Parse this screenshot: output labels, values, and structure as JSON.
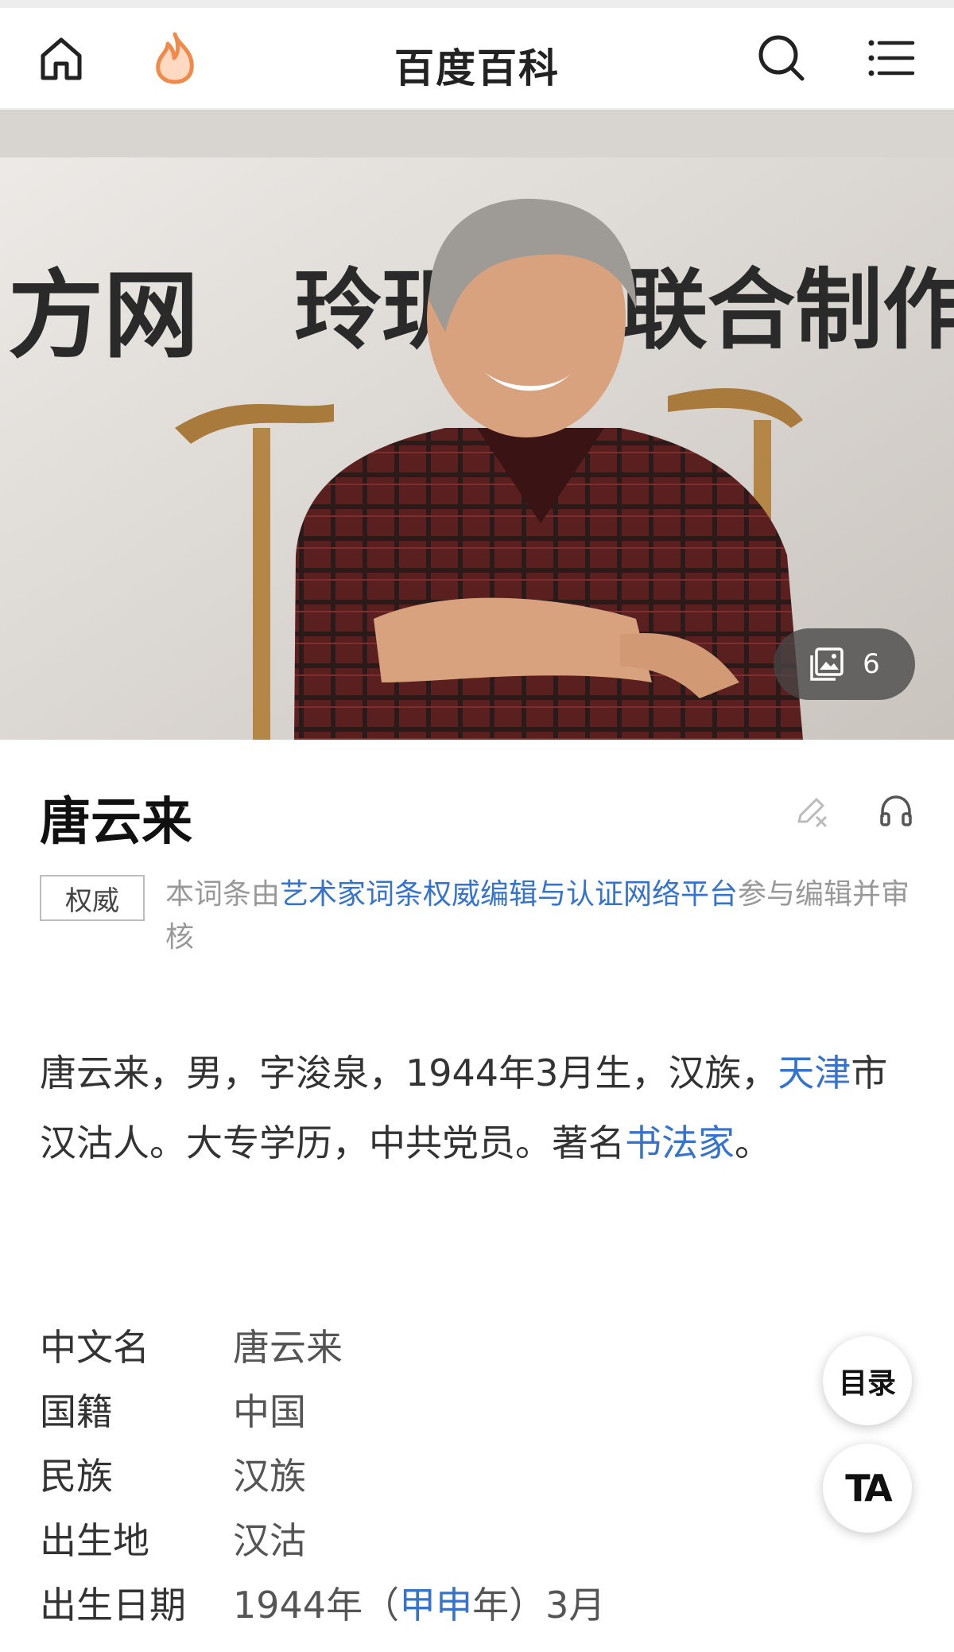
{
  "header": {
    "title": "百度百科",
    "icons": [
      "home-icon",
      "hot-flame-icon",
      "search-icon",
      "menu-icon"
    ]
  },
  "hero": {
    "background_text": [
      "方网",
      "玲玑",
      "联合制作"
    ],
    "album_count": "6"
  },
  "entry": {
    "title": "唐云来",
    "actions": [
      "edit-icon",
      "listen-icon"
    ]
  },
  "authority": {
    "badge": "权威",
    "prefix": "本词条由",
    "link": "艺术家词条权威编辑与认证网络平台",
    "suffix": "参与编辑并审核"
  },
  "summary": {
    "part1": "唐云来，男，字浚泉，1944年3月生，汉族，",
    "link1": "天津",
    "part2": "市汉沽人。大专学历，中共党员。著名",
    "link2": "书法家",
    "part3": "。"
  },
  "facts": [
    {
      "key": "中文名",
      "value": "唐云来"
    },
    {
      "key": "国籍",
      "value": "中国"
    },
    {
      "key": "民族",
      "value": "汉族"
    },
    {
      "key": "出生地",
      "value": "汉沽"
    },
    {
      "key": "出生日期",
      "value_pre": "1944年（",
      "value_link": "甲申",
      "value_post": "年）3月"
    }
  ],
  "floating": {
    "toc_label": "目录",
    "ta_label": "TA"
  },
  "colors": {
    "link": "#3573cc",
    "flame": "#f08a4b",
    "text": "#333333",
    "muted": "#999999"
  }
}
